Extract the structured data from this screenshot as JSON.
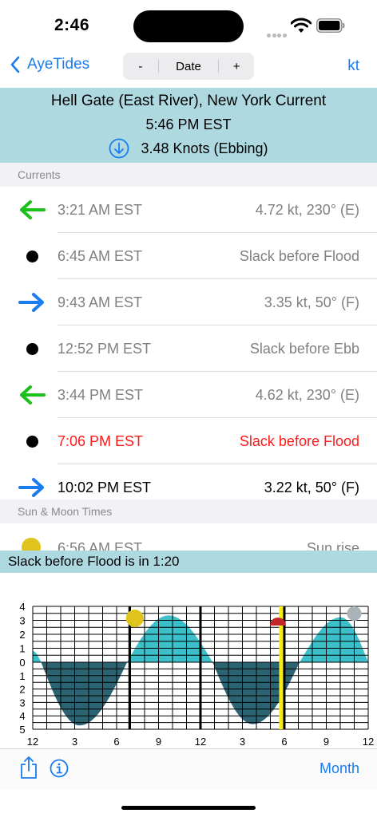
{
  "status_bar": {
    "time": "2:46"
  },
  "nav": {
    "back_label": "AyeTides",
    "minus_label": "-",
    "date_label": "Date",
    "plus_label": "+",
    "unit_label": "kt"
  },
  "station": {
    "name": "Hell Gate (East River), New York Current",
    "time": "5:46 PM EST",
    "speed": "3.48 Knots (Ebbing)"
  },
  "currents": {
    "header": "Currents",
    "rows": [
      {
        "time": "3:21 AM EST",
        "detail": "4.72 kt, 230° (E)",
        "icon": "arrow-left-icon",
        "state": "past"
      },
      {
        "time": "6:45 AM EST",
        "detail": "Slack before Flood",
        "icon": "slack-dot-icon",
        "state": "past"
      },
      {
        "time": "9:43 AM EST",
        "detail": "3.35 kt, 50° (F)",
        "icon": "arrow-right-icon",
        "state": "past"
      },
      {
        "time": "12:52 PM EST",
        "detail": "Slack before Ebb",
        "icon": "slack-dot-icon",
        "state": "past"
      },
      {
        "time": "3:44 PM EST",
        "detail": "4.62 kt, 230° (E)",
        "icon": "arrow-left-icon",
        "state": "past"
      },
      {
        "time": "7:06 PM EST",
        "detail": "Slack before Flood",
        "icon": "slack-dot-icon",
        "state": "current"
      },
      {
        "time": "10:02 PM EST",
        "detail": "3.22 kt, 50° (F)",
        "icon": "arrow-right-icon",
        "state": "future"
      }
    ]
  },
  "sun_moon": {
    "header": "Sun & Moon Times",
    "first_row": {
      "time": "6:56 AM EST",
      "detail": "Sun rise"
    }
  },
  "banner": {
    "text": "Slack before Flood is in 1:20"
  },
  "chart_data": {
    "type": "area",
    "y_ticks_top": [
      "4",
      "3",
      "2",
      "1",
      "0"
    ],
    "y_ticks_bottom": [
      "1",
      "2",
      "3",
      "4",
      "5"
    ],
    "x_ticks": [
      "12",
      "3",
      "6",
      "9",
      "12",
      "3",
      "6",
      "9",
      "12"
    ],
    "x_range_hours": [
      0,
      24
    ],
    "flood_positive_kt": [
      {
        "start_hour": 0.0,
        "peak_hour": 0.0,
        "end_hour": 0.6,
        "peak": 0.8
      },
      {
        "start_hour": 6.75,
        "peak_hour": 9.72,
        "end_hour": 12.87,
        "peak": 3.35
      },
      {
        "start_hour": 19.1,
        "peak_hour": 22.03,
        "end_hour": 24.0,
        "peak": 3.22
      }
    ],
    "ebb_negative_kt": [
      {
        "start_hour": 0.6,
        "peak_hour": 3.35,
        "end_hour": 6.75,
        "peak": 4.72
      },
      {
        "start_hour": 12.87,
        "peak_hour": 15.73,
        "end_hour": 19.1,
        "peak": 4.62
      }
    ],
    "now_hour": 17.77,
    "day_boundaries_hours": [
      6.93,
      12.0
    ],
    "grid": true,
    "colors": {
      "flood": "#3dbfca",
      "ebb": "#2b6373",
      "now_line": "#f4ee14",
      "sun": "#e0c41c",
      "moon": "#a9b3b8",
      "sunset": "#c0262a"
    }
  },
  "toolbar": {
    "month_label": "Month"
  },
  "colors": {
    "accent": "#1a7cf0",
    "header_bg": "#aed9e1",
    "arrow_green": "#1dbf1d",
    "arrow_blue": "#1a7cf0",
    "current_red": "#ff1a1a"
  }
}
